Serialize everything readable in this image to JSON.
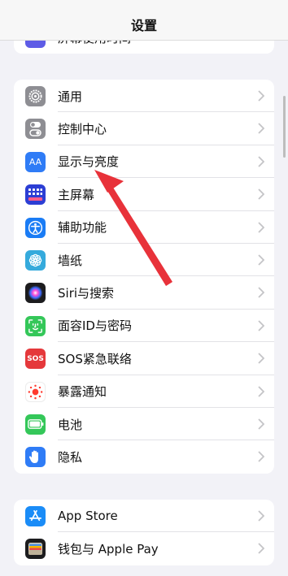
{
  "nav": {
    "title": "设置"
  },
  "top_group": {
    "partial_label": "屏幕使用时间"
  },
  "main_group": [
    {
      "label": "通用",
      "icon": "gear-icon",
      "color": "#8e8e93"
    },
    {
      "label": "控制中心",
      "icon": "toggles-icon",
      "color": "#8e8e93"
    },
    {
      "label": "显示与亮度",
      "icon": "text-size-icon",
      "color": "#2f7cf6",
      "glyph": "AA"
    },
    {
      "label": "主屏幕",
      "icon": "home-grid-icon",
      "color": "#2c3ed4"
    },
    {
      "label": "辅助功能",
      "icon": "accessibility-icon",
      "color": "#1a7cf5"
    },
    {
      "label": "墙纸",
      "icon": "flower-icon",
      "color": "#35aadc"
    },
    {
      "label": "Siri与搜索",
      "icon": "siri-icon",
      "color": "#1c1c1e"
    },
    {
      "label": "面容ID与密码",
      "icon": "face-id-icon",
      "color": "#34c759"
    },
    {
      "label": "SOS紧急联络",
      "icon": "sos-icon",
      "color": "#e5383b",
      "glyph": "SOS"
    },
    {
      "label": "暴露通知",
      "icon": "exposure-icon",
      "color": "#ffffff"
    },
    {
      "label": "电池",
      "icon": "battery-icon",
      "color": "#34c759"
    },
    {
      "label": "隐私",
      "icon": "hand-icon",
      "color": "#2f7cf6"
    }
  ],
  "store_group": [
    {
      "label": "App Store",
      "icon": "app-store-icon",
      "color": "#1a8cf7"
    },
    {
      "label": "钱包与 Apple Pay",
      "icon": "wallet-icon",
      "color": "#1c1c1e"
    }
  ]
}
